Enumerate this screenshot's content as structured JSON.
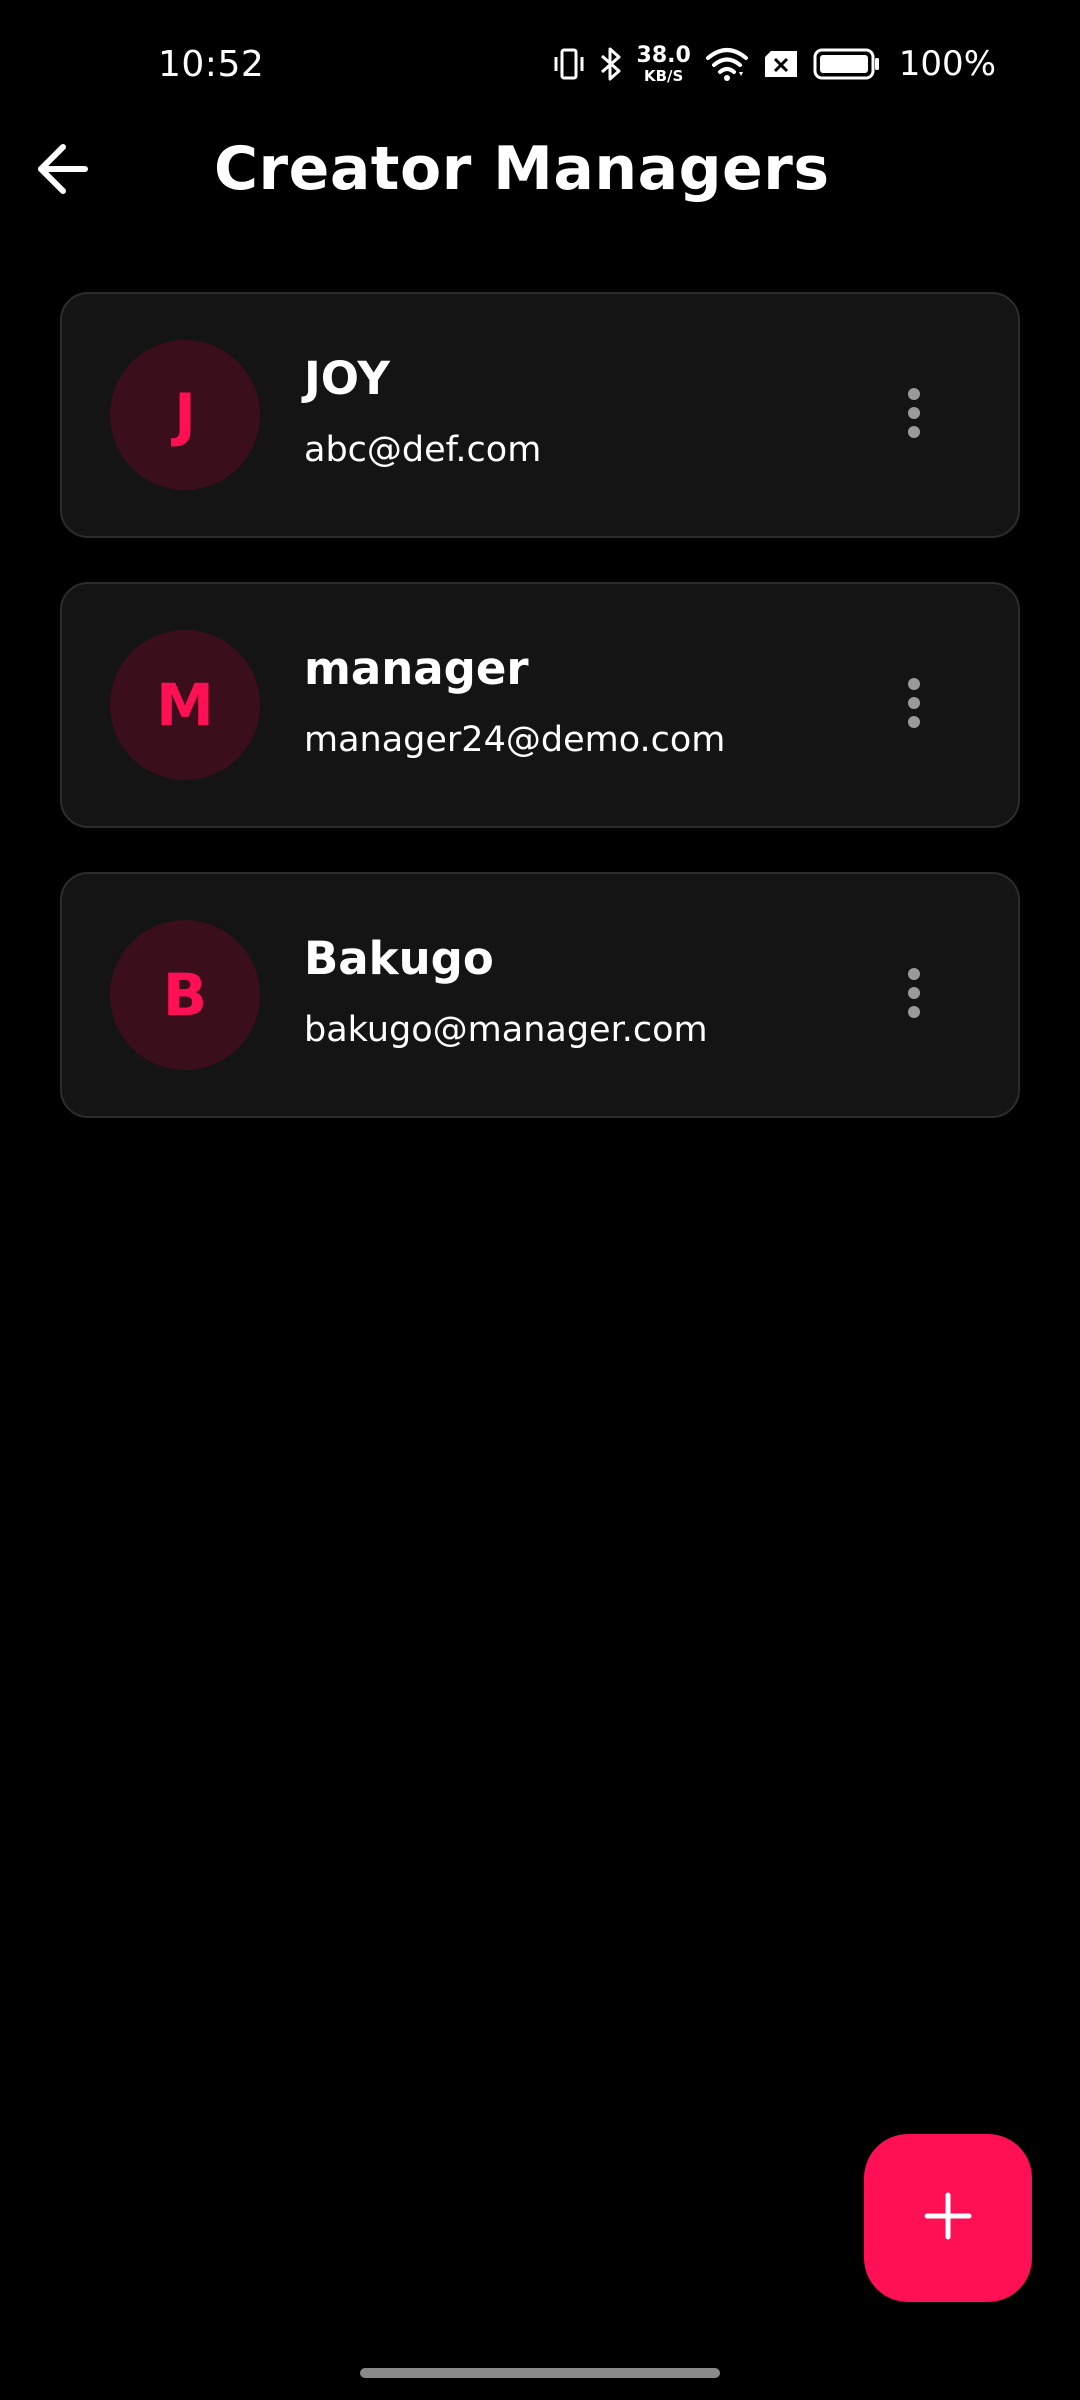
{
  "status_bar": {
    "time": "10:52",
    "net_speed_value": "38.0",
    "net_speed_unit": "KB/S",
    "battery_percent": "100%",
    "icons": [
      "vibrate-icon",
      "bluetooth-icon",
      "wifi-icon",
      "no-sim-icon",
      "battery-icon"
    ]
  },
  "header": {
    "title": "Creator Managers",
    "back_icon": "arrow-left-icon"
  },
  "managers": [
    {
      "initial": "J",
      "name": "JOY",
      "email": "abc@def.com"
    },
    {
      "initial": "M",
      "name": "manager",
      "email": "manager24@demo.com"
    },
    {
      "initial": "B",
      "name": "Bakugo",
      "email": "bakugo@manager.com"
    }
  ],
  "fab": {
    "icon": "plus-icon"
  },
  "colors": {
    "accent": "#ff0f53",
    "avatar_bg": "#3b0e1c",
    "card_bg": "#141414",
    "card_border": "#2c2c2c",
    "background": "#000000"
  }
}
